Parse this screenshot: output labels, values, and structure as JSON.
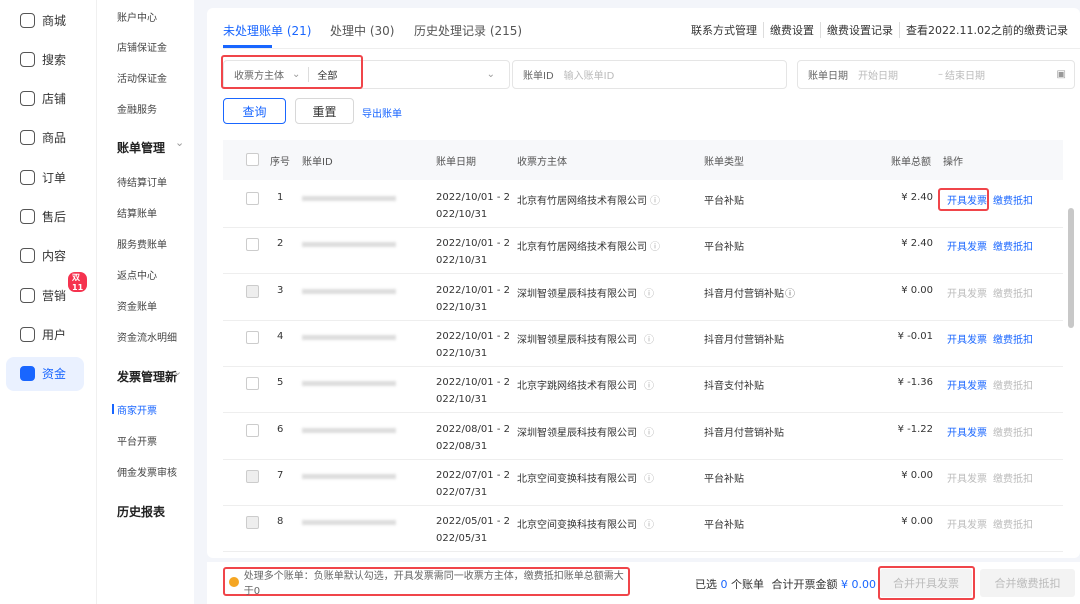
{
  "nav_primary": [
    {
      "label": "商城",
      "icon": "home-icon"
    },
    {
      "label": "搜索",
      "icon": "search-icon"
    },
    {
      "label": "店铺",
      "icon": "store-icon"
    },
    {
      "label": "商品",
      "icon": "product-icon"
    },
    {
      "label": "订单",
      "icon": "order-icon"
    },
    {
      "label": "售后",
      "icon": "after-sale-icon"
    },
    {
      "label": "内容",
      "icon": "content-icon"
    },
    {
      "label": "营销",
      "icon": "megaphone-icon",
      "badge": "双11"
    },
    {
      "label": "用户",
      "icon": "user-icon"
    },
    {
      "label": "资金",
      "icon": "wallet-icon",
      "active": true
    }
  ],
  "nav_secondary": [
    {
      "label": "账户中心"
    },
    {
      "label": "店铺保证金"
    },
    {
      "label": "活动保证金"
    },
    {
      "label": "金融服务"
    },
    {
      "label": "账单管理",
      "group": true
    },
    {
      "label": "待结算订单"
    },
    {
      "label": "结算账单"
    },
    {
      "label": "服务费账单"
    },
    {
      "label": "返点中心"
    },
    {
      "label": "资金账单"
    },
    {
      "label": "资金流水明细"
    },
    {
      "label": "发票管理新",
      "group": true
    },
    {
      "label": "商家开票",
      "selected": true
    },
    {
      "label": "平台开票"
    },
    {
      "label": "佣金发票审核"
    },
    {
      "label": "历史报表",
      "group": true
    }
  ],
  "tabs": [
    {
      "label": "未处理账单 (21)",
      "active": true
    },
    {
      "label": "处理中 (30)"
    },
    {
      "label": "历史处理记录 (215)"
    }
  ],
  "top_links": [
    "联系方式管理",
    "缴费设置",
    "缴费设置记录",
    "查看2022.11.02之前的缴费记录"
  ],
  "filters": {
    "entity_label": "收票方主体",
    "entity_value": "全部",
    "bill_id_label": "账单ID",
    "bill_id_placeholder": "输入账单ID",
    "date_label": "账单日期",
    "date_start_placeholder": "开始日期",
    "date_end_placeholder": "结束日期"
  },
  "buttons": {
    "query": "查询",
    "reset": "重置",
    "export": "导出账单"
  },
  "columns": [
    "序号",
    "账单ID",
    "账单日期",
    "收票方主体",
    "账单类型",
    "账单总额",
    "操作"
  ],
  "actions": {
    "invoice": "开具发票",
    "deduct": "缴费抵扣"
  },
  "rows": [
    {
      "no": "1",
      "date1": "2022/10/01 - 2",
      "date2": "022/10/31",
      "entity": "北京有竹居网络技术有限公司",
      "type": "平台补贴",
      "amount": "¥ 2.40",
      "invoice_enabled": true,
      "deduct_enabled": true,
      "disabled": false
    },
    {
      "no": "2",
      "date1": "2022/10/01 - 2",
      "date2": "022/10/31",
      "entity": "北京有竹居网络技术有限公司",
      "type": "平台补贴",
      "amount": "¥ 2.40",
      "invoice_enabled": true,
      "deduct_enabled": true,
      "disabled": false
    },
    {
      "no": "3",
      "date1": "2022/10/01 - 2",
      "date2": "022/10/31",
      "entity": "深圳智领星辰科技有限公司",
      "type": "抖音月付营销补贴",
      "amount": "¥ 0.00",
      "invoice_enabled": false,
      "deduct_enabled": false,
      "disabled": true
    },
    {
      "no": "4",
      "date1": "2022/10/01 - 2",
      "date2": "022/10/31",
      "entity": "深圳智领星辰科技有限公司",
      "type": "抖音月付营销补贴",
      "amount": "¥ -0.01",
      "invoice_enabled": true,
      "deduct_enabled": true,
      "disabled": false
    },
    {
      "no": "5",
      "date1": "2022/10/01 - 2",
      "date2": "022/10/31",
      "entity": "北京字跳网络技术有限公司",
      "type": "抖音支付补贴",
      "amount": "¥ -1.36",
      "invoice_enabled": true,
      "deduct_enabled": false,
      "disabled": false
    },
    {
      "no": "6",
      "date1": "2022/08/01 - 2",
      "date2": "022/08/31",
      "entity": "深圳智领星辰科技有限公司",
      "type": "抖音月付营销补贴",
      "amount": "¥ -1.22",
      "invoice_enabled": true,
      "deduct_enabled": false,
      "disabled": false
    },
    {
      "no": "7",
      "date1": "2022/07/01 - 2",
      "date2": "022/07/31",
      "entity": "北京空间变换科技有限公司",
      "type": "平台补贴",
      "amount": "¥ 0.00",
      "invoice_enabled": false,
      "deduct_enabled": false,
      "disabled": true
    },
    {
      "no": "8",
      "date1": "2022/05/01 - 2",
      "date2": "022/05/31",
      "entity": "北京空间变换科技有限公司",
      "type": "平台补贴",
      "amount": "¥ 0.00",
      "invoice_enabled": false,
      "deduct_enabled": false,
      "disabled": true
    }
  ],
  "footer": {
    "tip": "处理多个账单：负账单默认勾选，开具发票需同一收票方主体，缴费抵扣账单总额需大于0",
    "selected_prefix": "已选",
    "selected_count": "0",
    "selected_suffix": "个账单",
    "total_label": "合计开票金额",
    "total_value": "¥ 0.00",
    "merge_invoice": "合并开具发票",
    "merge_deduct": "合并缴费抵扣"
  },
  "colors": {
    "accent": "#1966ff",
    "highlight": "#f0454a"
  }
}
